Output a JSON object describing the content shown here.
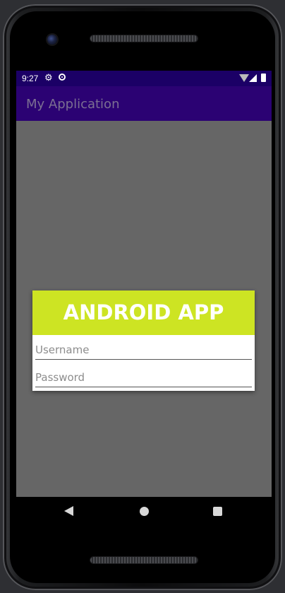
{
  "status_bar": {
    "time": "9:27",
    "icons": [
      "gear-icon",
      "sync-icon",
      "wifi-icon",
      "signal-icon",
      "battery-icon"
    ]
  },
  "app_bar": {
    "title": "My Application"
  },
  "dialog": {
    "header": "ANDROID APP",
    "username_placeholder": "Username",
    "username_value": "",
    "password_placeholder": "Password",
    "password_value": ""
  },
  "nav_bar": {
    "icons": [
      "back-icon",
      "home-icon",
      "recents-icon"
    ]
  },
  "colors": {
    "status_bar": "#1b0066",
    "app_bar": "#2b0273",
    "app_title": "#7b6f92",
    "dim_background": "#666666",
    "dialog_header": "#cde423"
  }
}
